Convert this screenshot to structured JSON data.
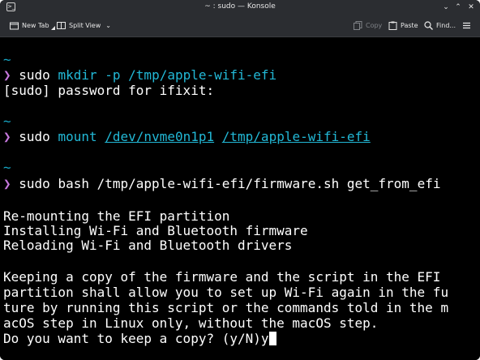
{
  "window": {
    "title": "~ : sudo — Konsole"
  },
  "toolbar": {
    "new_tab_label": "New Tab",
    "split_view_label": "Split View",
    "copy_label": "Copy",
    "paste_label": "Paste",
    "find_label": "Find..."
  },
  "terminal": {
    "tilde": "~",
    "prompt_symbol": "❯",
    "cmd1": {
      "sudo": "sudo",
      "program": "mkdir",
      "args": "-p /tmp/apple-wifi-efi"
    },
    "password_prompt": "[sudo] password for ifixit:",
    "cmd2": {
      "sudo": "sudo",
      "program": "mount",
      "device": "/dev/nvme0n1p1",
      "mountpoint": "/tmp/apple-wifi-efi"
    },
    "cmd3": {
      "sudo": "sudo",
      "rest": "bash /tmp/apple-wifi-efi/firmware.sh get_from_efi"
    },
    "output": [
      "Re-mounting the EFI partition",
      "Installing Wi-Fi and Bluetooth firmware",
      "Reloading Wi-Fi and Bluetooth drivers"
    ],
    "message": [
      "Keeping a copy of the firmware and the script in the EFI",
      "partition shall allow you to set up Wi-Fi again in the fu",
      "ture by running this script or the commands told in the m",
      "acOS step in Linux only, without the macOS step."
    ],
    "question": "Do you want to keep a copy? (y/N)y"
  }
}
